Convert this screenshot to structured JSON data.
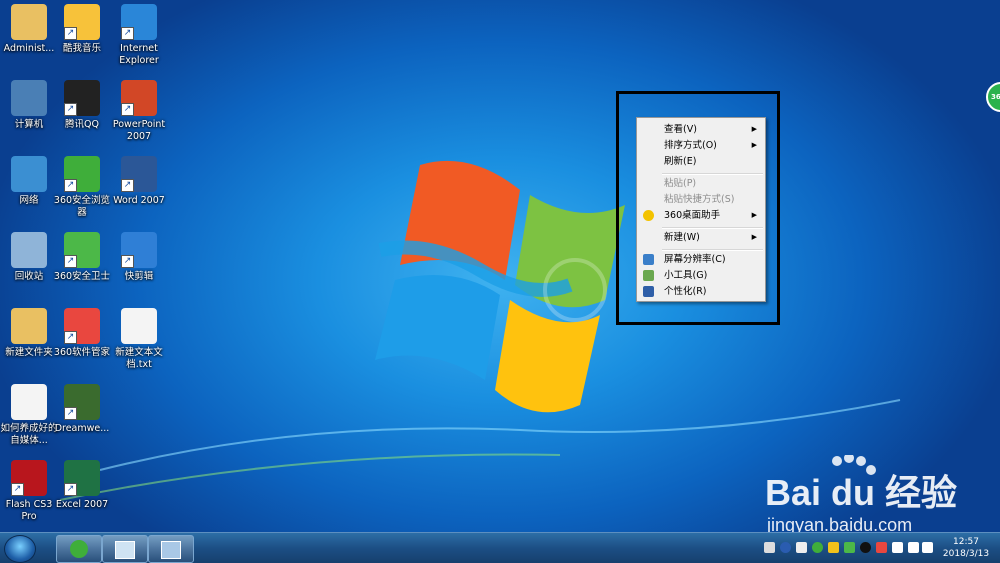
{
  "desktop_icons": [
    {
      "name": "administrator-folder-icon",
      "label": "Administ...",
      "color": "#e9c062",
      "shortcut": false
    },
    {
      "name": "kuwo-music-icon",
      "label": "酷我音乐",
      "color": "#f7c23a",
      "shortcut": true
    },
    {
      "name": "internet-explorer-icon",
      "label": "Internet Explorer",
      "color": "#2a86d8",
      "shortcut": true
    },
    {
      "name": "computer-icon",
      "label": "计算机",
      "color": "#4a7fb5",
      "shortcut": false
    },
    {
      "name": "qq-icon",
      "label": "腾讯QQ",
      "color": "#222222",
      "shortcut": true
    },
    {
      "name": "powerpoint-icon",
      "label": "PowerPoint 2007",
      "color": "#d24726",
      "shortcut": true
    },
    {
      "name": "network-icon",
      "label": "网络",
      "color": "#3b8fd2",
      "shortcut": false
    },
    {
      "name": "360-browser-icon",
      "label": "360安全浏览器",
      "color": "#3fae3a",
      "shortcut": true
    },
    {
      "name": "word-icon",
      "label": "Word 2007",
      "color": "#2b5797",
      "shortcut": true
    },
    {
      "name": "recycle-bin-icon",
      "label": "回收站",
      "color": "#8fb4d8",
      "shortcut": false
    },
    {
      "name": "360-security-icon",
      "label": "360安全卫士",
      "color": "#4cb848",
      "shortcut": true
    },
    {
      "name": "kuaijianji-icon",
      "label": "快剪辑",
      "color": "#2f7fd6",
      "shortcut": true
    },
    {
      "name": "new-folder-icon",
      "label": "新建文件夹",
      "color": "#e9c062",
      "shortcut": false
    },
    {
      "name": "360-software-manager-icon",
      "label": "360软件管家",
      "color": "#e9473f",
      "shortcut": true
    },
    {
      "name": "new-text-document-icon",
      "label": "新建文本文档.txt",
      "color": "#f4f4f4",
      "shortcut": false
    },
    {
      "name": "document-file-icon",
      "label": "如何养成好的自媒体...",
      "color": "#f4f4f4",
      "shortcut": false
    },
    {
      "name": "dreamweaver-icon",
      "label": "Dreamwe...",
      "color": "#3a6b2e",
      "shortcut": true
    },
    {
      "name": "flash-icon",
      "label": "Flash CS3 Pro",
      "color": "#b8161d",
      "shortcut": true
    },
    {
      "name": "excel-icon",
      "label": "Excel 2007",
      "color": "#1f7244",
      "shortcut": true
    }
  ],
  "context_menu": {
    "items": [
      {
        "name": "menu-item-view",
        "label": "查看(V)",
        "submenu": true,
        "disabled": false,
        "icon": ""
      },
      {
        "name": "menu-item-sort-by",
        "label": "排序方式(O)",
        "submenu": true,
        "disabled": false,
        "icon": ""
      },
      {
        "name": "menu-item-refresh",
        "label": "刷新(E)",
        "submenu": false,
        "disabled": false,
        "icon": ""
      },
      {
        "name": "menu-item-paste",
        "label": "粘贴(P)",
        "submenu": false,
        "disabled": true,
        "icon": ""
      },
      {
        "name": "menu-item-paste-shortcut",
        "label": "粘贴快捷方式(S)",
        "submenu": false,
        "disabled": true,
        "icon": ""
      },
      {
        "name": "menu-item-360-desktop-assistant",
        "label": "360桌面助手",
        "submenu": true,
        "disabled": false,
        "icon": "360-icon"
      },
      {
        "name": "menu-item-new",
        "label": "新建(W)",
        "submenu": true,
        "disabled": false,
        "icon": ""
      },
      {
        "name": "menu-item-screen-resolution",
        "label": "屏幕分辨率(C)",
        "submenu": false,
        "disabled": false,
        "icon": "monitor-icon"
      },
      {
        "name": "menu-item-gadgets",
        "label": "小工具(G)",
        "submenu": false,
        "disabled": false,
        "icon": "gadgets-icon"
      },
      {
        "name": "menu-item-personalize",
        "label": "个性化(R)",
        "submenu": false,
        "disabled": false,
        "icon": "personalize-icon"
      }
    ]
  },
  "side_badge": {
    "label": "36"
  },
  "watermark": {
    "logo_text": "Bai du 经验",
    "url": "jingyan.baidu.com"
  },
  "taskbar": {
    "clock": {
      "time": "12:57",
      "date": "2018/3/13"
    }
  }
}
